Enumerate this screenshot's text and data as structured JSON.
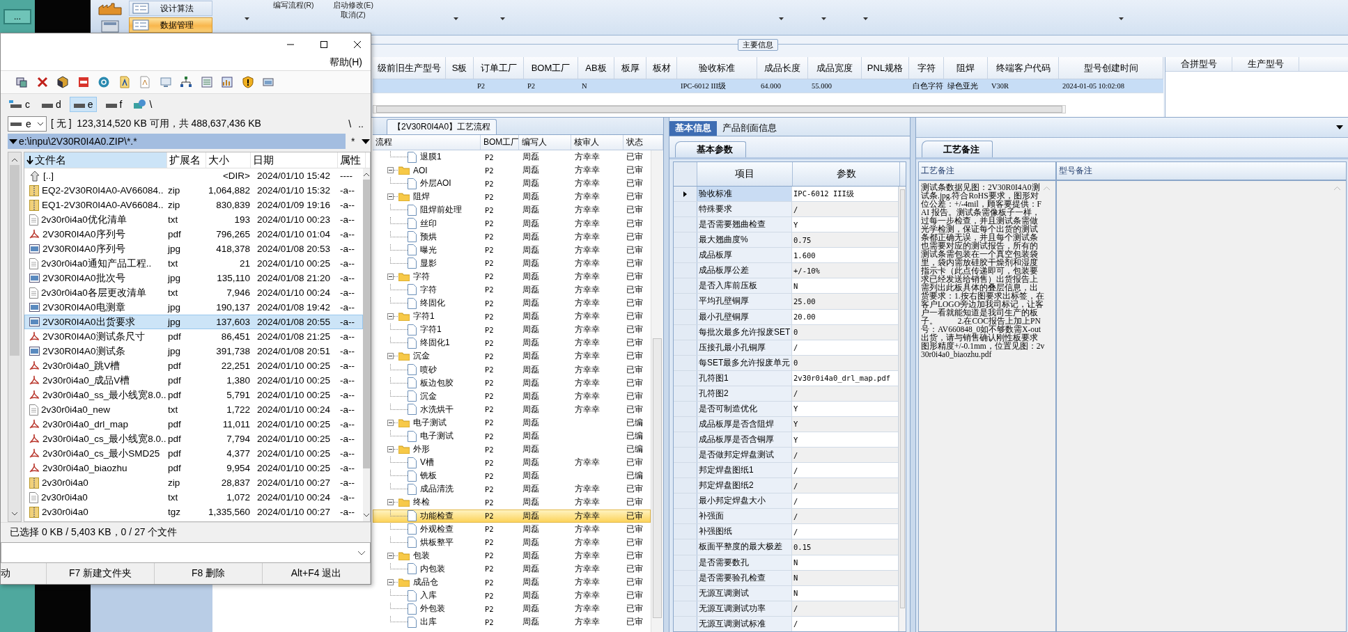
{
  "desktop": {
    "button": "..."
  },
  "ribbon": {
    "items": [
      {
        "label": "设计算法",
        "selected": false
      },
      {
        "label": "数据管理",
        "selected": true
      }
    ],
    "commands": [
      {
        "label": "编写流程(R)"
      },
      {
        "label": "启动修改(E)"
      },
      {
        "label": "取消(Z)"
      }
    ]
  },
  "main_info": {
    "title": "主要信息",
    "row_selected": true,
    "columns": [
      {
        "label": "级前旧生产型号"
      },
      {
        "label": "S板"
      },
      {
        "label": "订单工厂",
        "value": "P2"
      },
      {
        "label": "BOM工厂",
        "value": "P2"
      },
      {
        "label": "AB板",
        "value": "N"
      },
      {
        "label": "板厚"
      },
      {
        "label": "板材"
      },
      {
        "label": "验收标准",
        "value": "IPC-6012 III级"
      },
      {
        "label": "成品长度",
        "value": "64.000"
      },
      {
        "label": "成品宽度",
        "value": "55.000"
      },
      {
        "label": "PNL规格"
      },
      {
        "label": "字符",
        "value": "白色字符"
      },
      {
        "label": "阻焊",
        "value": "绿色亚光"
      },
      {
        "label": "终端客户代码",
        "value": "V30R"
      },
      {
        "label": "型号创建时间",
        "value": "2024-01-05 10:02:08"
      }
    ],
    "side_columns": [
      "合拼型号",
      "生产型号"
    ]
  },
  "file_manager": {
    "menu": "帮助(H)",
    "drives": [
      {
        "label": "c",
        "kind": "system",
        "selected": false
      },
      {
        "label": "d",
        "kind": "disk",
        "selected": false
      },
      {
        "label": "e",
        "kind": "disk",
        "selected": true
      },
      {
        "label": "f",
        "kind": "disk",
        "selected": false
      },
      {
        "label": "\\",
        "kind": "network",
        "selected": false
      }
    ],
    "drive_combo": "e",
    "free_space": "[ 无 ]  123,314,520 KB 可用，共 488,637,436 KB",
    "nav": [
      "\\",
      ".."
    ],
    "path": "e:\\inpu\\2V30R0I4A0.ZIP\\*.*",
    "filter": "*",
    "columns": [
      "文件名",
      "扩展名",
      "大小",
      "日期",
      "属性"
    ],
    "files": [
      {
        "name": "[..]",
        "kind": "parent",
        "size": "<DIR>",
        "date": "2024/01/10 15:42",
        "attr": "----",
        "selected": false
      },
      {
        "name": "EQ2-2V30R0I4A0-AV66084..",
        "ext": "zip",
        "kind": "archive",
        "size": "1,064,882",
        "date": "2024/01/10 15:32",
        "attr": "-a--",
        "selected": false
      },
      {
        "name": "EQ1-2V30R0I4A0-AV66084..",
        "ext": "zip",
        "kind": "archive",
        "size": "830,839",
        "date": "2024/01/09 19:16",
        "attr": "-a--",
        "selected": false
      },
      {
        "name": "2v30r0i4a0优化清单",
        "ext": "txt",
        "kind": "text",
        "size": "193",
        "date": "2024/01/10 00:23",
        "attr": "-a--",
        "selected": false
      },
      {
        "name": "2V30R0I4A0序列号",
        "ext": "pdf",
        "kind": "pdf",
        "size": "796,265",
        "date": "2024/01/10 01:04",
        "attr": "-a--",
        "selected": false
      },
      {
        "name": "2V30R0I4A0序列号",
        "ext": "jpg",
        "kind": "image",
        "size": "418,378",
        "date": "2024/01/08 20:53",
        "attr": "-a--",
        "selected": false
      },
      {
        "name": "2v30r0i4a0通知产品工程..",
        "ext": "txt",
        "kind": "text",
        "size": "21",
        "date": "2024/01/10 00:25",
        "attr": "-a--",
        "selected": false
      },
      {
        "name": "2V30R0I4A0批次号",
        "ext": "jpg",
        "kind": "image",
        "size": "135,110",
        "date": "2024/01/08 21:20",
        "attr": "-a--",
        "selected": false
      },
      {
        "name": "2v30r0i4a0各层更改清单",
        "ext": "txt",
        "kind": "text",
        "size": "7,946",
        "date": "2024/01/10 00:24",
        "attr": "-a--",
        "selected": false
      },
      {
        "name": "2V30R0I4A0电测章",
        "ext": "jpg",
        "kind": "image",
        "size": "190,137",
        "date": "2024/01/08 19:42",
        "attr": "-a--",
        "selected": false
      },
      {
        "name": "2V30R0I4A0出货要求",
        "ext": "jpg",
        "kind": "image",
        "size": "137,603",
        "date": "2024/01/08 20:55",
        "attr": "-a--",
        "selected": true
      },
      {
        "name": "2V30R0I4A0测试条尺寸",
        "ext": "pdf",
        "kind": "pdf",
        "size": "86,451",
        "date": "2024/01/08 21:25",
        "attr": "-a--",
        "selected": false
      },
      {
        "name": "2V30R0I4A0测试条",
        "ext": "jpg",
        "kind": "image",
        "size": "391,738",
        "date": "2024/01/08 20:51",
        "attr": "-a--",
        "selected": false
      },
      {
        "name": "2v30r0i4a0_跳V槽",
        "ext": "pdf",
        "kind": "pdf",
        "size": "22,251",
        "date": "2024/01/10 00:25",
        "attr": "-a--",
        "selected": false
      },
      {
        "name": "2v30r0i4a0_成品V槽",
        "ext": "pdf",
        "kind": "pdf",
        "size": "1,380",
        "date": "2024/01/10 00:25",
        "attr": "-a--",
        "selected": false
      },
      {
        "name": "2v30r0i4a0_ss_最小线宽8.0..",
        "ext": "pdf",
        "kind": "pdf",
        "size": "5,791",
        "date": "2024/01/10 00:25",
        "attr": "-a--",
        "selected": false
      },
      {
        "name": "2v30r0i4a0_new",
        "ext": "txt",
        "kind": "text",
        "size": "1,722",
        "date": "2024/01/10 00:24",
        "attr": "-a--",
        "selected": false
      },
      {
        "name": "2v30r0i4a0_drl_map",
        "ext": "pdf",
        "kind": "pdf",
        "size": "11,011",
        "date": "2024/01/10 00:25",
        "attr": "-a--",
        "selected": false
      },
      {
        "name": "2v30r0i4a0_cs_最小线宽8.0..",
        "ext": "pdf",
        "kind": "pdf",
        "size": "7,794",
        "date": "2024/01/10 00:25",
        "attr": "-a--",
        "selected": false
      },
      {
        "name": "2v30r0i4a0_cs_最小SMD25",
        "ext": "pdf",
        "kind": "pdf",
        "size": "4,377",
        "date": "2024/01/10 00:25",
        "attr": "-a--",
        "selected": false
      },
      {
        "name": "2v30r0i4a0_biaozhu",
        "ext": "pdf",
        "kind": "pdf",
        "size": "9,954",
        "date": "2024/01/10 00:25",
        "attr": "-a--",
        "selected": false
      },
      {
        "name": "2v30r0i4a0",
        "ext": "zip",
        "kind": "archive",
        "size": "28,837",
        "date": "2024/01/10 00:27",
        "attr": "-a--",
        "selected": false
      },
      {
        "name": "2v30r0i4a0",
        "ext": "txt",
        "kind": "text",
        "size": "1,072",
        "date": "2024/01/10 00:24",
        "attr": "-a--",
        "selected": false
      },
      {
        "name": "2v30r0i4a0",
        "ext": "tgz",
        "kind": "archive",
        "size": "1,335,560",
        "date": "2024/01/10 00:27",
        "attr": "-a--",
        "selected": false
      }
    ],
    "status": "已选择 0 KB / 5,403 KB，0 / 27 个文件",
    "function_keys": [
      "动",
      "F7 新建文件夹",
      "F8 删除",
      "Alt+F4 退出"
    ]
  },
  "process": {
    "tab": "【2V30R0I4A0】工艺流程",
    "columns": [
      "流程",
      "BOM工厂",
      "编写人",
      "核审人",
      "状态"
    ],
    "nodes": [
      {
        "label": "退膜1",
        "kind": "file",
        "bom": "P2",
        "writer": "周磊",
        "reviewer": "方幸幸",
        "status": "已审",
        "selected": false
      },
      {
        "label": "AOI",
        "kind": "folder",
        "expanded": true,
        "bom": "P2",
        "writer": "周磊",
        "reviewer": "方幸幸",
        "status": "已审",
        "selected": false,
        "children": [
          {
            "label": "外层AOI",
            "kind": "file",
            "bom": "P2",
            "writer": "周磊",
            "reviewer": "方幸幸",
            "status": "已审",
            "selected": false
          }
        ]
      },
      {
        "label": "阻焊",
        "kind": "folder",
        "expanded": true,
        "bom": "P2",
        "writer": "周磊",
        "reviewer": "方幸幸",
        "status": "已审",
        "selected": false,
        "children": [
          {
            "label": "阻焊前处理",
            "kind": "file",
            "bom": "P2",
            "writer": "周磊",
            "reviewer": "方幸幸",
            "status": "已审",
            "selected": false
          },
          {
            "label": "丝印",
            "kind": "file",
            "bom": "P2",
            "writer": "周磊",
            "reviewer": "方幸幸",
            "status": "已审",
            "selected": false
          },
          {
            "label": "预烘",
            "kind": "file",
            "bom": "P2",
            "writer": "周磊",
            "reviewer": "方幸幸",
            "status": "已审",
            "selected": false
          },
          {
            "label": "曝光",
            "kind": "file",
            "bom": "P2",
            "writer": "周磊",
            "reviewer": "方幸幸",
            "status": "已审",
            "selected": false
          },
          {
            "label": "显影",
            "kind": "file",
            "bom": "P2",
            "writer": "周磊",
            "reviewer": "方幸幸",
            "status": "已审",
            "selected": false
          }
        ]
      },
      {
        "label": "字符",
        "kind": "folder",
        "expanded": true,
        "bom": "P2",
        "writer": "周磊",
        "reviewer": "方幸幸",
        "status": "已审",
        "selected": false,
        "children": [
          {
            "label": "字符",
            "kind": "file",
            "bom": "P2",
            "writer": "周磊",
            "reviewer": "方幸幸",
            "status": "已审",
            "selected": false
          },
          {
            "label": "终固化",
            "kind": "file",
            "bom": "P2",
            "writer": "周磊",
            "reviewer": "方幸幸",
            "status": "已审",
            "selected": false
          }
        ]
      },
      {
        "label": "字符1",
        "kind": "folder",
        "expanded": true,
        "bom": "P2",
        "writer": "周磊",
        "reviewer": "方幸幸",
        "status": "已审",
        "selected": false,
        "children": [
          {
            "label": "字符1",
            "kind": "file",
            "bom": "P2",
            "writer": "周磊",
            "reviewer": "方幸幸",
            "status": "已审",
            "selected": false
          },
          {
            "label": "终固化1",
            "kind": "file",
            "bom": "P2",
            "writer": "周磊",
            "reviewer": "方幸幸",
            "status": "已审",
            "selected": false
          }
        ]
      },
      {
        "label": "沉金",
        "kind": "folder",
        "expanded": true,
        "bom": "P2",
        "writer": "周磊",
        "reviewer": "方幸幸",
        "status": "已审",
        "selected": false,
        "children": [
          {
            "label": "喷砂",
            "kind": "file",
            "bom": "P2",
            "writer": "周磊",
            "reviewer": "方幸幸",
            "status": "已审",
            "selected": false
          },
          {
            "label": "板边包胶",
            "kind": "file",
            "bom": "P2",
            "writer": "周磊",
            "reviewer": "方幸幸",
            "status": "已审",
            "selected": false
          },
          {
            "label": "沉金",
            "kind": "file",
            "bom": "P2",
            "writer": "周磊",
            "reviewer": "方幸幸",
            "status": "已审",
            "selected": false
          },
          {
            "label": "水洗烘干",
            "kind": "file",
            "bom": "P2",
            "writer": "周磊",
            "reviewer": "方幸幸",
            "status": "已审",
            "selected": false
          }
        ]
      },
      {
        "label": "电子测试",
        "kind": "folder",
        "expanded": true,
        "bom": "P2",
        "writer": "周磊",
        "status": "已编",
        "selected": false,
        "children": [
          {
            "label": "电子测试",
            "kind": "file",
            "bom": "P2",
            "writer": "周磊",
            "status": "已编",
            "selected": false
          }
        ]
      },
      {
        "label": "外形",
        "kind": "folder",
        "expanded": true,
        "bom": "P2",
        "writer": "周磊",
        "status": "已编",
        "selected": false,
        "children": [
          {
            "label": "V槽",
            "kind": "file",
            "bom": "P2",
            "writer": "周磊",
            "reviewer": "方幸幸",
            "status": "已审",
            "selected": false
          },
          {
            "label": "铣板",
            "kind": "file",
            "bom": "P2",
            "writer": "周磊",
            "status": "已编",
            "selected": false
          },
          {
            "label": "成品清洗",
            "kind": "file",
            "bom": "P2",
            "writer": "周磊",
            "reviewer": "方幸幸",
            "status": "已审",
            "selected": false
          }
        ]
      },
      {
        "label": "终检",
        "kind": "folder",
        "expanded": true,
        "bom": "P2",
        "writer": "周磊",
        "reviewer": "方幸幸",
        "status": "已审",
        "selected": false,
        "children": [
          {
            "label": "功能检查",
            "kind": "file",
            "bom": "P2",
            "writer": "周磊",
            "reviewer": "方幸幸",
            "status": "已审",
            "selected": true
          },
          {
            "label": "外观检查",
            "kind": "file",
            "bom": "P2",
            "writer": "周磊",
            "reviewer": "方幸幸",
            "status": "已审",
            "selected": false
          },
          {
            "label": "烘板整平",
            "kind": "file",
            "bom": "P2",
            "writer": "周磊",
            "reviewer": "方幸幸",
            "status": "已审",
            "selected": false
          }
        ]
      },
      {
        "label": "包装",
        "kind": "folder",
        "expanded": true,
        "bom": "P2",
        "writer": "周磊",
        "reviewer": "方幸幸",
        "status": "已审",
        "selected": false,
        "children": [
          {
            "label": "内包装",
            "kind": "file",
            "bom": "P2",
            "writer": "周磊",
            "reviewer": "方幸幸",
            "status": "已审",
            "selected": false
          }
        ]
      },
      {
        "label": "成品仓",
        "kind": "folder",
        "expanded": true,
        "bom": "P2",
        "writer": "周磊",
        "reviewer": "方幸幸",
        "status": "已审",
        "selected": false,
        "children": [
          {
            "label": "入库",
            "kind": "file",
            "bom": "P2",
            "writer": "周磊",
            "reviewer": "方幸幸",
            "status": "已审",
            "selected": false
          },
          {
            "label": "外包装",
            "kind": "file",
            "bom": "P2",
            "writer": "周磊",
            "reviewer": "方幸幸",
            "status": "已审",
            "selected": false
          },
          {
            "label": "出库",
            "kind": "file",
            "bom": "P2",
            "writer": "周磊",
            "reviewer": "方幸幸",
            "status": "已审",
            "selected": false
          }
        ]
      }
    ]
  },
  "basic_info": {
    "tabs": [
      {
        "label": "基本信息",
        "selected": true
      },
      {
        "label": "产品剖面信息",
        "selected": false
      }
    ],
    "subtab": "基本参数",
    "columns": [
      "项目",
      "参数"
    ],
    "rows": [
      {
        "item": "验收标准",
        "value": "IPC-6012 III级",
        "selected": true
      },
      {
        "item": "特殊要求",
        "value": "/",
        "selected": false
      },
      {
        "item": "是否需要翘曲检查",
        "value": "Y",
        "selected": false
      },
      {
        "item": "最大翘曲度%",
        "value": "0.75",
        "selected": false
      },
      {
        "item": "成品板厚",
        "value": "1.600",
        "selected": false
      },
      {
        "item": "成品板厚公差",
        "value": "+/-10%",
        "selected": false
      },
      {
        "item": "是否入库前压板",
        "value": "N",
        "selected": false
      },
      {
        "item": "平均孔壁铜厚",
        "value": "25.00",
        "selected": false
      },
      {
        "item": "最小孔壁铜厚",
        "value": "20.00",
        "selected": false
      },
      {
        "item": "每批次最多允许报废SET",
        "value": "0",
        "selected": false
      },
      {
        "item": "压接孔最小孔铜厚",
        "value": "/",
        "selected": false
      },
      {
        "item": "每SET最多允许报废单元",
        "value": "0",
        "selected": false
      },
      {
        "item": "孔符图1",
        "value": "2v30r0i4a0_drl_map.pdf",
        "selected": false
      },
      {
        "item": "孔符图2",
        "value": "/",
        "selected": false
      },
      {
        "item": "是否可制造优化",
        "value": "Y",
        "selected": false
      },
      {
        "item": "成品板厚是否含阻焊",
        "value": "Y",
        "selected": false
      },
      {
        "item": "成品板厚是否含铜厚",
        "value": "Y",
        "selected": false
      },
      {
        "item": "是否做邦定焊盘测试",
        "value": "/",
        "selected": false
      },
      {
        "item": "邦定焊盘图纸1",
        "value": "/",
        "selected": false
      },
      {
        "item": "邦定焊盘图纸2",
        "value": "/",
        "selected": false
      },
      {
        "item": "最小邦定焊盘大小",
        "value": "/",
        "selected": false
      },
      {
        "item": "补强面",
        "value": "/",
        "selected": false
      },
      {
        "item": "补强图纸",
        "value": "/",
        "selected": false
      },
      {
        "item": "板面平整度的最大极差",
        "value": "0.15",
        "selected": false
      },
      {
        "item": "是否需要数孔",
        "value": "N",
        "selected": false
      },
      {
        "item": "是否需要验孔检查",
        "value": "N",
        "selected": false
      },
      {
        "item": "无源互调测试",
        "value": "N",
        "selected": false
      },
      {
        "item": "无源互调测试功率",
        "value": "/",
        "selected": false
      },
      {
        "item": "无源互调测试标准",
        "value": "/",
        "selected": false
      }
    ]
  },
  "notes": {
    "tab": "工艺备注",
    "columns": [
      "工艺备注",
      "型号备注"
    ],
    "process_note": "测试条数据见图：2V30R0I4A0测试条.jpg.符合RoHS要求，图形对位公差：+/-4mil，顾客要提供：FAI 报告。测试条需像板子一样，过每一步检查，并且测试条需做光学检测，保证每个出货的测试条都正确无误，并且每个测试条也需要对应的测试报告，所有的测试条需包装在一个真空包装袋里，袋内需放硅胶干燥剂和湿度指示卡（此点传递即可，包装要求已经发送给销售）出货报告上需列出此板具体的叠层信息，出货要求：1.按右图要求出标签，在客户LOGO旁边加我司标记，让客户一看就能知道是我司生产的板子。          2.在COC报告上加上PN号：AV660848_0如不够数需X-out出货，请与销售确认刚性板要求图形精度+/-0.1mm，位置见图：2v30r0i4a0_biaozhu.pdf"
  }
}
